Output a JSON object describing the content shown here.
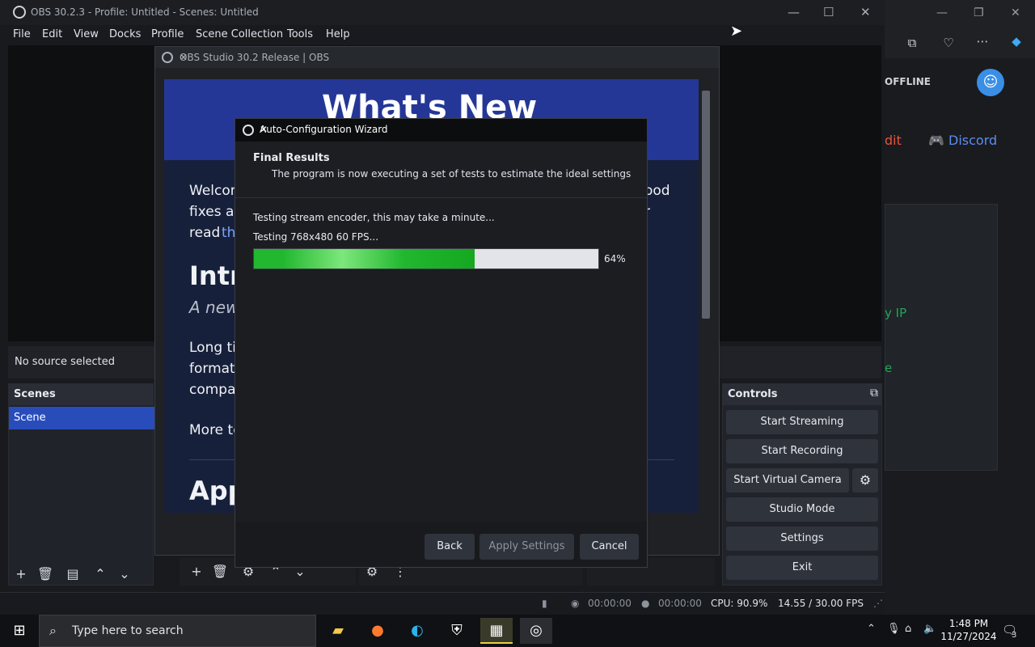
{
  "obs": {
    "title": "OBS 30.2.3 - Profile: Untitled - Scenes: Untitled",
    "menu": [
      "File",
      "Edit",
      "View",
      "Docks",
      "Profile",
      "Scene Collection",
      "Tools",
      "Help"
    ],
    "no_source": "No source selected",
    "scenes_header": "Scenes",
    "scene_item": "Scene",
    "controls_header": "Controls",
    "controls": {
      "start_streaming": "Start Streaming",
      "start_recording": "Start Recording",
      "start_virtual_camera": "Start Virtual Camera",
      "studio_mode": "Studio Mode",
      "settings": "Settings",
      "exit": "Exit"
    },
    "status": {
      "stream_time": "00:00:00",
      "rec_time": "00:00:00",
      "cpu": "CPU: 90.9%",
      "fps": "14.55 / 30.00 FPS"
    }
  },
  "whatsnew": {
    "title": "OBS Studio 30.2 Release | OBS",
    "heading": "What's New",
    "welcome": "Welcom",
    "fixes": "fixes an",
    "read": "read",
    "link": "th",
    "good": "ood",
    "r": "r",
    "intro": "Intr",
    "anew": "A new",
    "long": "Long tir",
    "format": "format",
    "compat": "compat",
    "more": "More te",
    "app": "App"
  },
  "wizard": {
    "title": "Auto-Configuration Wizard",
    "heading": "Final Results",
    "subtitle": "The program is now executing a set of tests to estimate the ideal settings",
    "line1": "Testing stream encoder, this may take a minute...",
    "line2": "Testing 768x480 60 FPS...",
    "progress": 64,
    "progress_label": "64%",
    "back": "Back",
    "apply": "Apply Settings",
    "cancel": "Cancel"
  },
  "browser": {
    "offline": "OFFLINE",
    "discord": "Discord",
    "reddit": "dit",
    "copyip": "y IP",
    "e": "e"
  },
  "taskbar": {
    "search_placeholder": "Type here to search",
    "time": "1:48 PM",
    "date": "11/27/2024",
    "notif": "3"
  },
  "colors": {
    "accent": "#284dbb",
    "progress": "#21b72f",
    "discord": "#5b8cf5"
  }
}
